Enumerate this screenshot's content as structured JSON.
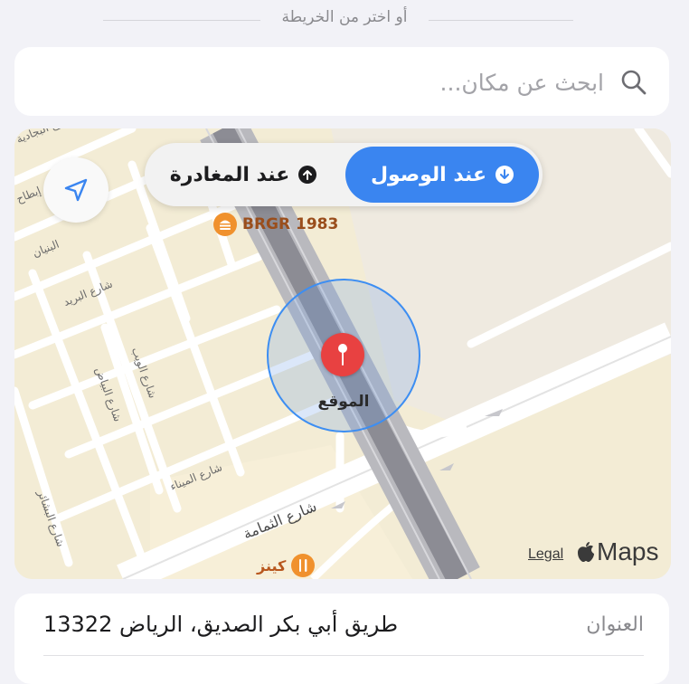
{
  "divider": {
    "text": "أو اختر من الخريطة"
  },
  "search": {
    "placeholder": "ابحث عن مكان..."
  },
  "map": {
    "segmented": {
      "arrive_label": "عند الوصول",
      "leave_label": "عند المغادرة",
      "selected": "arrive"
    },
    "streets": {
      "s1": "شارع البجادية",
      "s2": "إبطاح",
      "s3": "البنيان",
      "s4": "شارع البريد",
      "s5": "شارع الويب",
      "s6": "شارع البياض",
      "s7": "شارع الميناء",
      "s8": "شارع البشائر",
      "s9": "شارع الثمامة"
    },
    "poi_brgr": "BRGR 1983",
    "poi_kenz": "كينز",
    "pin_label": "الموقع",
    "legal": "Legal",
    "maps_brand": "Maps",
    "colors": {
      "accent": "#3a85f0",
      "pin": "#e84141",
      "poi": "#f0912d"
    }
  },
  "address": {
    "label": "العنوان",
    "value": "طريق أبي بكر الصديق، الرياض 13322"
  }
}
